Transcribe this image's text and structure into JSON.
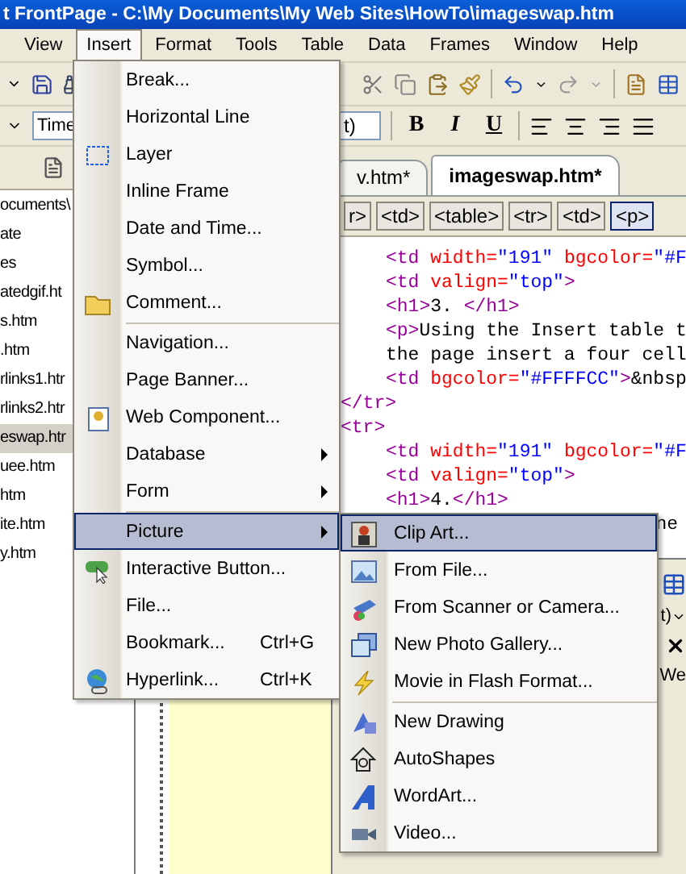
{
  "title_bar": {
    "title": "t FrontPage - C:\\My Documents\\My Web Sites\\HowTo\\imageswap.htm"
  },
  "menu_bar": [
    {
      "label": "View",
      "selected": false
    },
    {
      "label": "Insert",
      "selected": true
    },
    {
      "label": "Format",
      "selected": false
    },
    {
      "label": "Tools",
      "selected": false
    },
    {
      "label": "Table",
      "selected": false
    },
    {
      "label": "Data",
      "selected": false
    },
    {
      "label": "Frames",
      "selected": false
    },
    {
      "label": "Window",
      "selected": false
    },
    {
      "label": "Help",
      "selected": false
    }
  ],
  "format_toolbar": {
    "font": "Time",
    "size": "t)",
    "style_buttons": [
      "B",
      "I",
      "U"
    ]
  },
  "folder_list": [
    {
      "label": "ocuments\\",
      "selected": false
    },
    {
      "label": "ate",
      "selected": false
    },
    {
      "label": "es",
      "selected": false
    },
    {
      "label": "atedgif.ht",
      "selected": false
    },
    {
      "label": "s.htm",
      "selected": false
    },
    {
      "label": ".htm",
      "selected": false
    },
    {
      "label": "rlinks1.htr",
      "selected": false
    },
    {
      "label": "rlinks2.htr",
      "selected": false
    },
    {
      "label": "eswap.htr",
      "selected": true
    },
    {
      "label": "uee.htm",
      "selected": false
    },
    {
      "label": "htm",
      "selected": false
    },
    {
      "label": "ite.htm",
      "selected": false
    },
    {
      "label": "y.htm",
      "selected": false
    }
  ],
  "document_tabs": [
    {
      "label": "v.htm*",
      "selected": false
    },
    {
      "label": "imageswap.htm*",
      "selected": true
    }
  ],
  "tag_selector": [
    {
      "label": "r>",
      "selected": false
    },
    {
      "label": "<td>",
      "selected": false
    },
    {
      "label": "<table>",
      "selected": false
    },
    {
      "label": "<tr>",
      "selected": false
    },
    {
      "label": "<td>",
      "selected": false
    },
    {
      "label": "<p>",
      "selected": true
    }
  ],
  "code_lines": [
    {
      "indented": true,
      "tokens": [
        {
          "kind": "tag",
          "text": "<td "
        },
        {
          "kind": "attr",
          "text": "width="
        },
        {
          "kind": "value",
          "text": "\"191\""
        },
        {
          "kind": "attr",
          "text": " bgcolor="
        },
        {
          "kind": "value",
          "text": "\"#F"
        }
      ]
    },
    {
      "indented": true,
      "tokens": [
        {
          "kind": "tag",
          "text": "<td "
        },
        {
          "kind": "attr",
          "text": "valign="
        },
        {
          "kind": "value",
          "text": "\"top\""
        },
        {
          "kind": "tag",
          "text": ">"
        }
      ]
    },
    {
      "indented": true,
      "tokens": [
        {
          "kind": "tag",
          "text": "<h1>"
        },
        {
          "kind": "text",
          "text": "3. "
        },
        {
          "kind": "tag",
          "text": "</h1>"
        }
      ]
    },
    {
      "indented": true,
      "tokens": [
        {
          "kind": "tag",
          "text": "<p>"
        },
        {
          "kind": "text",
          "text": "Using the Insert table t"
        }
      ]
    },
    {
      "indented": true,
      "tokens": [
        {
          "kind": "text",
          "text": "the page insert a four cell"
        }
      ]
    },
    {
      "indented": true,
      "tokens": [
        {
          "kind": "tag",
          "text": "<td "
        },
        {
          "kind": "attr",
          "text": "bgcolor="
        },
        {
          "kind": "value",
          "text": "\"#FFFFCC\""
        },
        {
          "kind": "tag",
          "text": ">"
        },
        {
          "kind": "text",
          "text": "&nbsp"
        }
      ]
    },
    {
      "indented": false,
      "tokens": [
        {
          "kind": "tag",
          "text": "</tr>"
        }
      ]
    },
    {
      "indented": false,
      "tokens": [
        {
          "kind": "tag",
          "text": "<tr>"
        }
      ]
    },
    {
      "indented": true,
      "tokens": [
        {
          "kind": "tag",
          "text": "<td "
        },
        {
          "kind": "attr",
          "text": "width="
        },
        {
          "kind": "value",
          "text": "\"191\""
        },
        {
          "kind": "attr",
          "text": " bgcolor="
        },
        {
          "kind": "value",
          "text": "\"#F"
        }
      ]
    },
    {
      "indented": true,
      "tokens": [
        {
          "kind": "tag",
          "text": "<td "
        },
        {
          "kind": "attr",
          "text": "valign="
        },
        {
          "kind": "value",
          "text": "\"top\""
        },
        {
          "kind": "tag",
          "text": ">"
        }
      ]
    },
    {
      "indented": true,
      "tokens": [
        {
          "kind": "tag",
          "text": "<h1>"
        },
        {
          "kind": "text",
          "text": "4."
        },
        {
          "kind": "tag",
          "text": "</h1>"
        }
      ]
    }
  ],
  "code_tail": "ne",
  "side_panel": {
    "size": "t)",
    "text": "We"
  },
  "insert_menu": [
    {
      "kind": "item",
      "label": "Break...",
      "has_submenu": false,
      "selected": false
    },
    {
      "kind": "item",
      "label": "Horizontal Line",
      "has_submenu": false,
      "selected": false
    },
    {
      "kind": "item",
      "label": "Layer",
      "has_submenu": false,
      "selected": false
    },
    {
      "kind": "item",
      "label": "Inline Frame",
      "has_submenu": false,
      "selected": false
    },
    {
      "kind": "item",
      "label": "Date and Time...",
      "has_submenu": false,
      "selected": false
    },
    {
      "kind": "item",
      "label": "Symbol...",
      "has_submenu": false,
      "selected": false
    },
    {
      "kind": "item",
      "label": "Comment...",
      "has_submenu": false,
      "selected": false
    },
    {
      "kind": "separator"
    },
    {
      "kind": "item",
      "label": "Navigation...",
      "has_submenu": false,
      "selected": false
    },
    {
      "kind": "item",
      "label": "Page Banner...",
      "has_submenu": false,
      "selected": false
    },
    {
      "kind": "item",
      "label": "Web Component...",
      "has_submenu": false,
      "selected": false
    },
    {
      "kind": "item",
      "label": "Database",
      "has_submenu": true,
      "selected": false
    },
    {
      "kind": "item",
      "label": "Form",
      "has_submenu": true,
      "selected": false
    },
    {
      "kind": "separator"
    },
    {
      "kind": "item",
      "label": "Picture",
      "has_submenu": true,
      "selected": true
    },
    {
      "kind": "item",
      "label": "Interactive Button...",
      "has_submenu": false,
      "selected": false
    },
    {
      "kind": "item",
      "label": "File...",
      "has_submenu": false,
      "selected": false
    },
    {
      "kind": "item",
      "label": "Bookmark...",
      "shortcut": "Ctrl+G",
      "has_submenu": false,
      "selected": false
    },
    {
      "kind": "item",
      "label": "Hyperlink...",
      "shortcut": "Ctrl+K",
      "has_submenu": false,
      "selected": false
    }
  ],
  "picture_submenu": [
    {
      "kind": "item",
      "label": "Clip Art...",
      "selected": true
    },
    {
      "kind": "item",
      "label": "From File...",
      "selected": false
    },
    {
      "kind": "item",
      "label": "From Scanner or Camera...",
      "selected": false
    },
    {
      "kind": "item",
      "label": "New Photo Gallery...",
      "selected": false
    },
    {
      "kind": "item",
      "label": "Movie in Flash Format...",
      "selected": false
    },
    {
      "kind": "separator"
    },
    {
      "kind": "item",
      "label": "New Drawing",
      "selected": false
    },
    {
      "kind": "item",
      "label": "AutoShapes",
      "selected": false
    },
    {
      "kind": "item",
      "label": "WordArt...",
      "selected": false
    },
    {
      "kind": "item",
      "label": "Video...",
      "selected": false
    }
  ]
}
